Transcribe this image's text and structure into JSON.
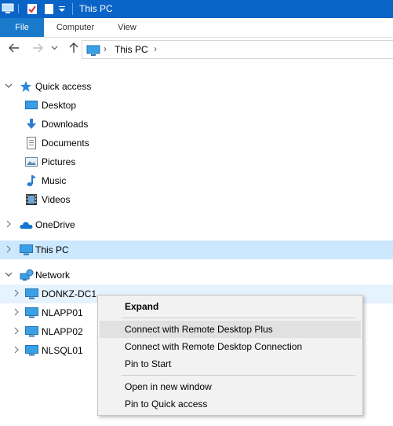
{
  "window": {
    "title": "This PC"
  },
  "ribbon": {
    "tabs": [
      "File",
      "Computer",
      "View"
    ]
  },
  "address": {
    "crumb": "This PC"
  },
  "tree": {
    "quick_access": "Quick access",
    "qa_items": [
      {
        "label": "Desktop",
        "icon": "desktop-icon"
      },
      {
        "label": "Downloads",
        "icon": "downloads-icon"
      },
      {
        "label": "Documents",
        "icon": "documents-icon"
      },
      {
        "label": "Pictures",
        "icon": "pictures-icon"
      },
      {
        "label": "Music",
        "icon": "music-icon"
      },
      {
        "label": "Videos",
        "icon": "videos-icon"
      }
    ],
    "onedrive": "OneDrive",
    "this_pc": "This PC",
    "network": "Network",
    "computers": [
      "DONKZ-DC1",
      "NLAPP01",
      "NLAPP02",
      "NLSQL01"
    ]
  },
  "context_menu": {
    "items": [
      {
        "label": "Expand"
      },
      {
        "label": "Connect with Remote Desktop Plus"
      },
      {
        "label": "Connect with Remote Desktop Connection"
      },
      {
        "label": "Pin to Start"
      },
      {
        "label": "Open in new window"
      },
      {
        "label": "Pin to Quick access"
      }
    ]
  },
  "colors": {
    "titlebar": "#0a64c8",
    "file_tab": "#1979ca",
    "selection": "#cce8ff",
    "hover": "#e5f3ff",
    "menu_bg": "#f2f2f2"
  }
}
